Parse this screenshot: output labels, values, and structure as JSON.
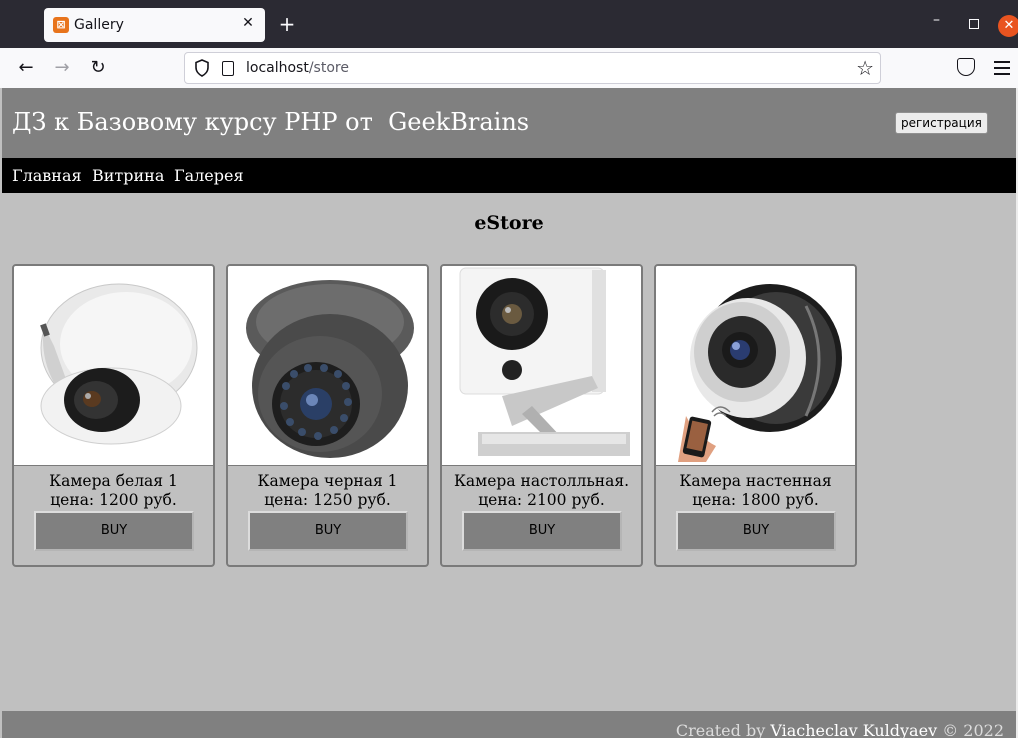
{
  "browser": {
    "tab_title": "Gallery",
    "tab_favicon": "xampp-icon",
    "url_host": "localhost",
    "url_path": "/store"
  },
  "site": {
    "title": "ДЗ к Базовому курсу PHP от  GeekBrains",
    "register_label": "регистрация",
    "nav": [
      "Главная",
      "Витрина",
      "Галерея"
    ],
    "heading": "eStore"
  },
  "products": [
    {
      "name": "Камера белая 1",
      "price": "цена: 1200 руб.",
      "buy": "BUY",
      "image": "white-dome-camera"
    },
    {
      "name": "Камера черная 1",
      "price": "цена: 1250 руб.",
      "buy": "BUY",
      "image": "grey-dome-camera"
    },
    {
      "name": "Камера настолльная.",
      "price": "цена: 2100 руб.",
      "buy": "BUY",
      "image": "desk-wifi-camera"
    },
    {
      "name": "Камера настенная",
      "price": "цена: 1800 руб.",
      "buy": "BUY",
      "image": "wall-spherical-camera"
    }
  ],
  "footer": {
    "prefix": "Created by ",
    "author": "Viacheclav Kuldyaev",
    "suffix": " © 2022"
  },
  "colors": {
    "header_bg": "#808080",
    "nav_bg": "#000000",
    "page_bg": "#c0c0c0",
    "button_bg": "#808080"
  }
}
